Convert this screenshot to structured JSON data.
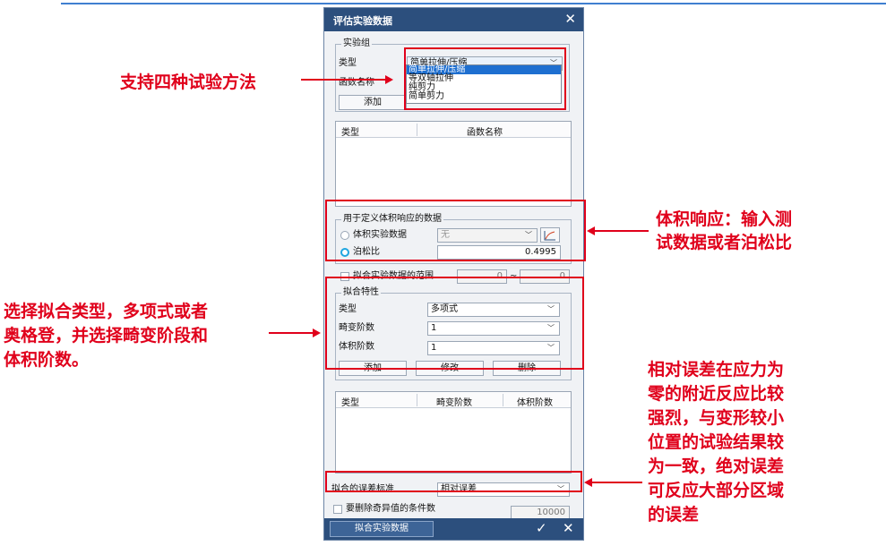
{
  "dialog": {
    "title": "评估实验数据",
    "close_glyph": "✕",
    "experiment_group": {
      "legend": "实验组",
      "type_label": "类型",
      "type_value": "简单拉伸/压缩",
      "function_name_label": "函数名称",
      "add_button": "添加",
      "dropdown_options": [
        "简单拉伸/压缩",
        "等双轴拉伸",
        "纯剪力",
        "简单剪力"
      ]
    },
    "experiment_table": {
      "columns": [
        "类型",
        "函数名称"
      ]
    },
    "volumetric": {
      "legend": "用于定义体积响应的数据",
      "volumetric_data_label": "体积实验数据",
      "volumetric_data_value": "无",
      "poisson_label": "泊松比",
      "poisson_value": "0.4995"
    },
    "fit_range": {
      "label": "拟合实验数据的范围",
      "min": "0",
      "separator": "~",
      "max": "0"
    },
    "fit_props": {
      "legend": "拟合特性",
      "type_label": "类型",
      "type_value": "多项式",
      "distortion_label": "畸变阶数",
      "distortion_value": "1",
      "volume_label": "体积阶数",
      "volume_value": "1",
      "add_button": "添加",
      "modify_button": "修改",
      "delete_button": "删除"
    },
    "fit_table": {
      "columns": [
        "类型",
        "畸变阶数",
        "体积阶数"
      ]
    },
    "error_criterion": {
      "label": "拟合的误差标准",
      "value": "相对误差"
    },
    "singular": {
      "label": "要删除奇异值的条件数",
      "value": "10000"
    },
    "footer": {
      "fit_button": "拟合实验数据",
      "ok_glyph": "✓",
      "cancel_glyph": "✕"
    }
  },
  "annotations": {
    "methods": "支持四种试验方法",
    "volume_line1": "体积响应：输入测",
    "volume_line2": "试数据或者泊松比",
    "fit_line1": "选择拟合类型，多项式或者",
    "fit_line2": "奥格登，并选择畸变阶段和",
    "fit_line3": "体积阶数。",
    "error_lines": [
      "相对误差在应力为",
      "零的附近反应比较",
      "强烈，与变形较小",
      "位置的试验结果较",
      "为一致，绝对误差",
      "可反应大部分区域",
      "的误差"
    ]
  },
  "colors": {
    "accent": "#e0001b",
    "title_bar": "#2c4f7d",
    "highlight": "#1e6fd0"
  }
}
